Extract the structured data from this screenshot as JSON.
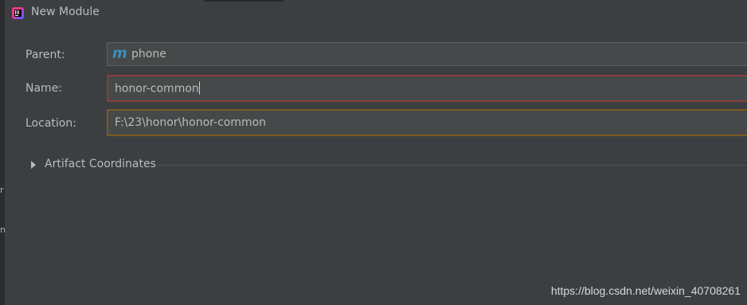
{
  "window": {
    "title": "New Module",
    "app_icon": "intellij-idea-icon"
  },
  "left_strip": {
    "glyphs": [
      "r",
      "n"
    ]
  },
  "form": {
    "parent": {
      "label": "Parent:",
      "value": "phone",
      "icon": "maven-icon",
      "icon_glyph": "m"
    },
    "name": {
      "label": "Name:",
      "value": "honor-common",
      "state": "error",
      "border_color": "#8b3c3c"
    },
    "location": {
      "label": "Location:",
      "value": "F:\\23\\honor\\honor-common",
      "state": "warning",
      "border_color": "#7a5b1e"
    }
  },
  "sections": [
    {
      "label": "Artifact Coordinates",
      "expanded": false
    }
  ],
  "watermark": "https://blog.csdn.net/weixin_40708261",
  "colors": {
    "background": "#3c3f41",
    "text": "#bbbbbb",
    "field_bg": "#45494a"
  }
}
